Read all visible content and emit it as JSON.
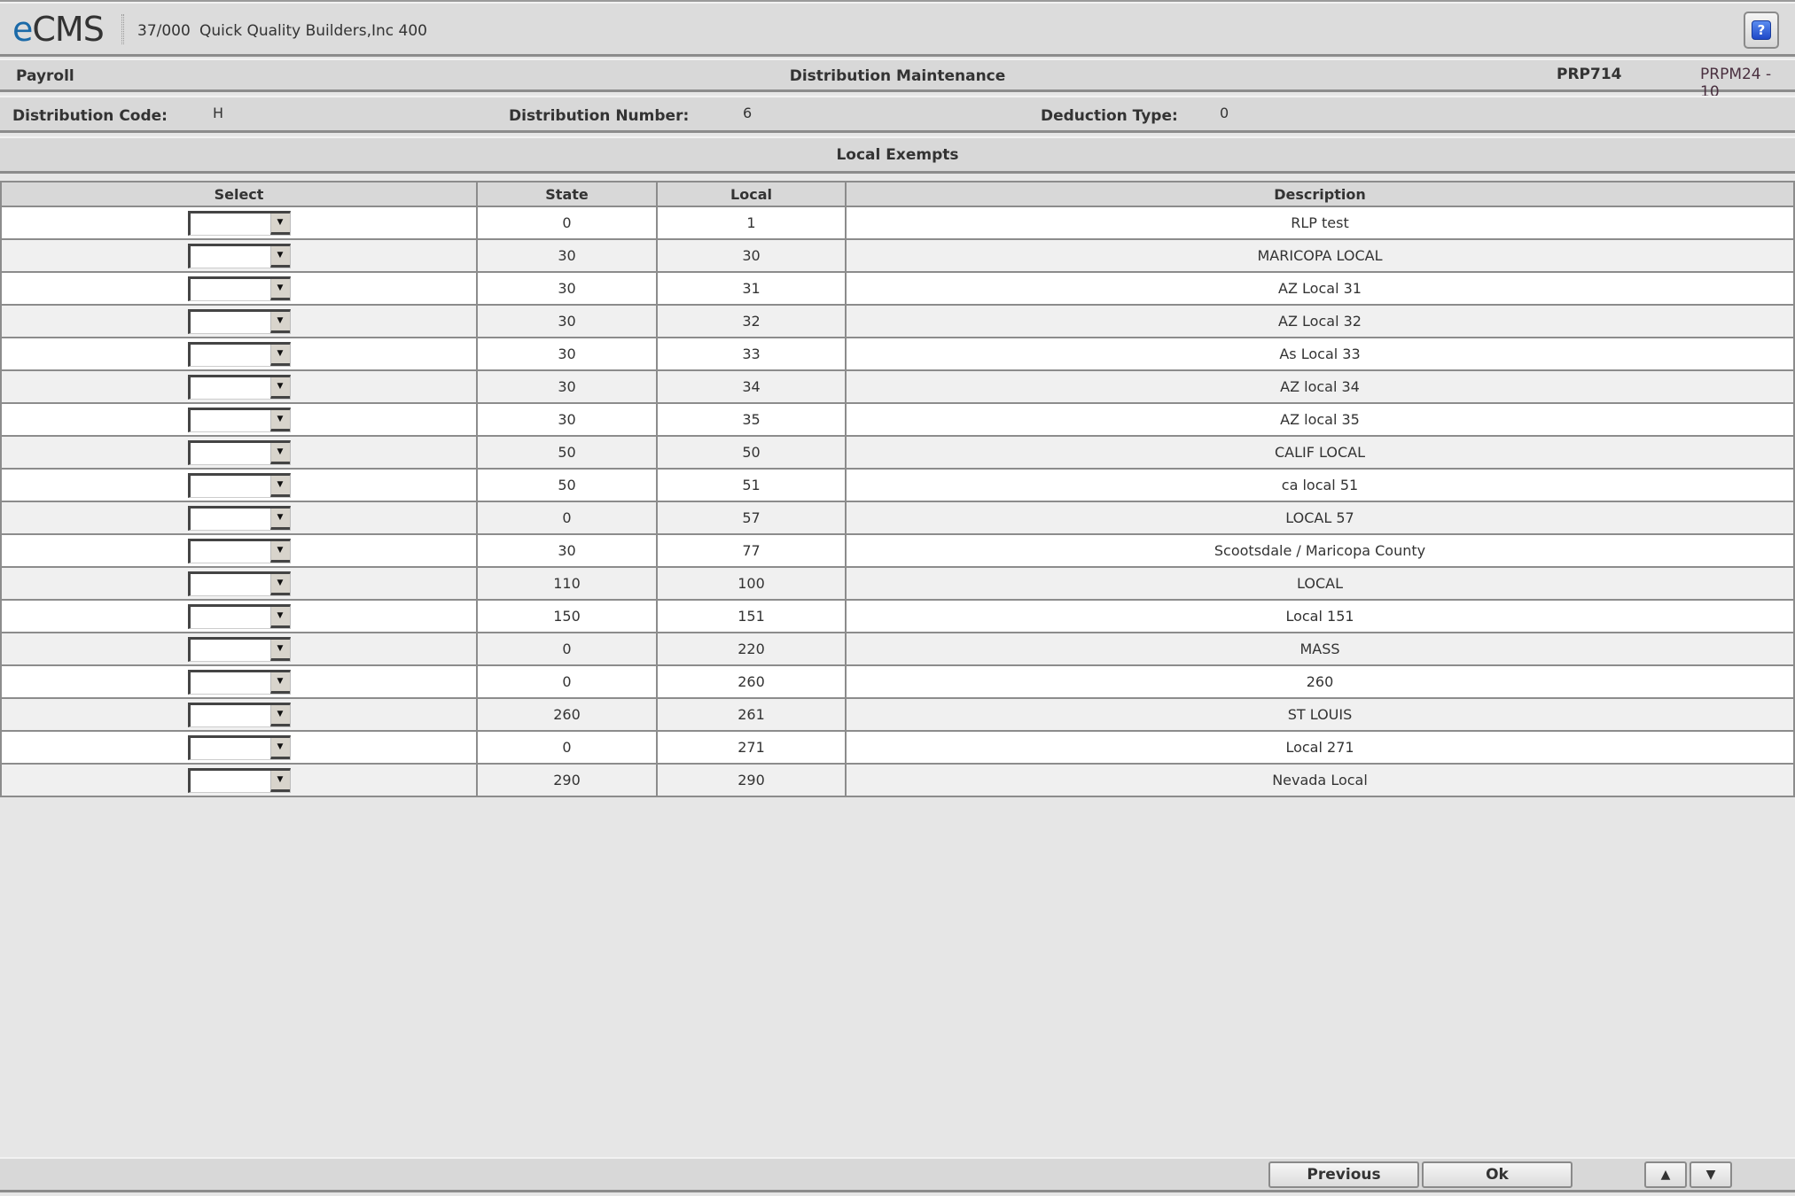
{
  "header": {
    "logo_prefix": "e",
    "logo_rest": "CMS",
    "company_code": "37/000",
    "company_name": "Quick Quality Builders,Inc 400",
    "help_icon": "?"
  },
  "titlebar": {
    "module": "Payroll",
    "screen_title": "Distribution Maintenance",
    "program_id": "PRP714",
    "screen_id": "PRPM24 - 10"
  },
  "fields": {
    "distribution_code_label": "Distribution Code:",
    "distribution_code_value": "H",
    "distribution_number_label": "Distribution Number:",
    "distribution_number_value": "6",
    "deduction_type_label": "Deduction Type:",
    "deduction_type_value": "0"
  },
  "section": {
    "title": "Local Exempts"
  },
  "table": {
    "columns": [
      "Select",
      "State",
      "Local",
      "Description"
    ],
    "rows": [
      {
        "select": "",
        "state": "0",
        "local": "1",
        "description": "RLP test"
      },
      {
        "select": "",
        "state": "30",
        "local": "30",
        "description": "MARICOPA LOCAL"
      },
      {
        "select": "",
        "state": "30",
        "local": "31",
        "description": "AZ Local 31"
      },
      {
        "select": "",
        "state": "30",
        "local": "32",
        "description": "AZ Local 32"
      },
      {
        "select": "",
        "state": "30",
        "local": "33",
        "description": "As Local 33"
      },
      {
        "select": "",
        "state": "30",
        "local": "34",
        "description": "AZ local 34"
      },
      {
        "select": "",
        "state": "30",
        "local": "35",
        "description": "AZ local 35"
      },
      {
        "select": "",
        "state": "50",
        "local": "50",
        "description": "CALIF LOCAL"
      },
      {
        "select": "",
        "state": "50",
        "local": "51",
        "description": "ca local 51"
      },
      {
        "select": "",
        "state": "0",
        "local": "57",
        "description": "LOCAL 57"
      },
      {
        "select": "",
        "state": "30",
        "local": "77",
        "description": "Scootsdale / Maricopa County"
      },
      {
        "select": "",
        "state": "110",
        "local": "100",
        "description": "LOCAL"
      },
      {
        "select": "",
        "state": "150",
        "local": "151",
        "description": "Local 151"
      },
      {
        "select": "",
        "state": "0",
        "local": "220",
        "description": "MASS"
      },
      {
        "select": "",
        "state": "0",
        "local": "260",
        "description": "260"
      },
      {
        "select": "",
        "state": "260",
        "local": "261",
        "description": "ST LOUIS"
      },
      {
        "select": "",
        "state": "0",
        "local": "271",
        "description": "Local 271"
      },
      {
        "select": "",
        "state": "290",
        "local": "290",
        "description": "Nevada Local"
      }
    ]
  },
  "footer": {
    "previous_label": "Previous",
    "ok_label": "Ok",
    "page_up_icon": "▲",
    "page_down_icon": "▼"
  },
  "icons": {
    "dropdown_arrow": "▼"
  },
  "colors": {
    "logo_accent": "#1b6aa8",
    "help_icon_blue": "#2a5ad8",
    "bar_bg": "#d8d8d8",
    "row_alt": "#f0f0f0"
  }
}
